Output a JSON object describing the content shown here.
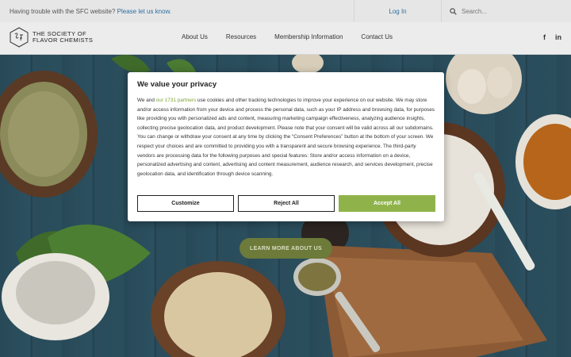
{
  "topbar": {
    "notice_text": "Having trouble with the SFC website?",
    "notice_link": "Please let us know.",
    "login_label": "Log In",
    "search_placeholder": "Search..."
  },
  "nav": {
    "logo_line1": "THE SOCIETY OF",
    "logo_line2": "FLAVOR CHEMISTS",
    "items": [
      "About Us",
      "Resources",
      "Membership Information",
      "Contact Us"
    ],
    "social": [
      "f",
      "in"
    ]
  },
  "hero": {
    "cta_label": "LEARN MORE ABOUT US"
  },
  "cookie_dialog": {
    "title": "We value your privacy",
    "body_prefix": "We and",
    "partners_link": "our 1731 partners",
    "body_rest": "use cookies and other tracking technologies to improve your experience on our website. We may store and/or access information from your device and process the personal data, such as your IP address and browsing data, for purposes like providing you with personalized ads and content, measuring marketing campaign effectiveness, analyzing audience insights, collecting precise geolocation data, and product development. Please note that your consent will be valid across all our subdomains. You can change or withdraw your consent at any time by clicking the “Consent Preferences” button at the bottom of your screen. We respect your choices and are committed to providing you with a transparent and secure browsing experience. The third-party vendors are processing data for the following purposes and special features: Store and/or access information on a device, personalized advertising and content, advertising and content measurement, audience research, and services development, precise geolocation data, and identification through device scanning.",
    "customize_label": "Customize",
    "reject_label": "Reject All",
    "accept_label": "Accept All"
  },
  "colors": {
    "accent_green": "#8fb34a",
    "link_blue": "#2e6f9e",
    "cta_olive": "#6c7a3a"
  }
}
